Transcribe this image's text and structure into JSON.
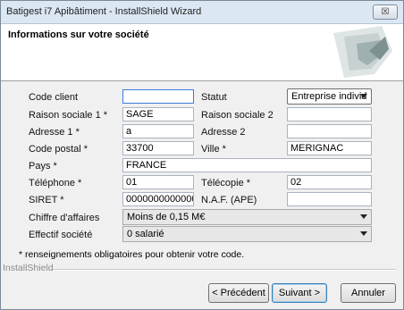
{
  "window": {
    "title": "Batigest i7 Apibâtiment - InstallShield Wizard",
    "close_glyph": "☒"
  },
  "header": {
    "title": "Informations sur votre société"
  },
  "labels": {
    "code_client": "Code client",
    "statut": "Statut",
    "raison1": "Raison sociale 1 *",
    "raison2": "Raison sociale 2",
    "adresse1": "Adresse 1 *",
    "adresse2": "Adresse 2",
    "code_postal": "Code postal *",
    "ville": "Ville *",
    "pays": "Pays *",
    "telephone": "Téléphone *",
    "telecopie": "Télécopie *",
    "siret": "SIRET *",
    "naf": "N.A.F. (APE)",
    "ca": "Chiffre d'affaires",
    "effectif": "Effectif société"
  },
  "values": {
    "code_client": "",
    "statut": "Entreprise individ",
    "raison1": "SAGE",
    "raison2": "",
    "adresse1": "a",
    "adresse2": "",
    "code_postal": "33700",
    "ville": "MERIGNAC",
    "pays": "FRANCE",
    "telephone": "01",
    "telecopie": "02",
    "siret": "00000000000000",
    "naf": "",
    "ca": "Moins de 0,15 M€",
    "effectif": "0 salarié"
  },
  "note": "* renseignements obligatoires pour obtenir votre code.",
  "footer_brand": "InstallShield",
  "buttons": {
    "prev": "< Précédent",
    "next": "Suivant >",
    "cancel": "Annuler"
  }
}
